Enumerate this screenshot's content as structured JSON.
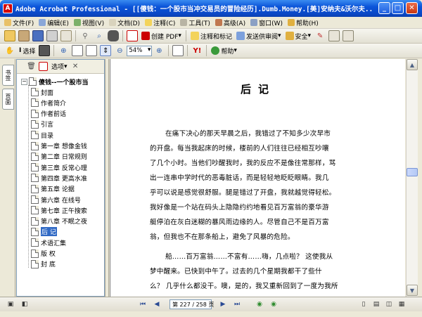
{
  "window": {
    "title": "Adobe Acrobat Professional - [[傻钱：一个股市当冲交易员的冒险经历].Dumb.Money.[美]安纳夫&沃尔夫..."
  },
  "menu": [
    "文件(F)",
    "编辑(E)",
    "视图(V)",
    "文档(D)",
    "注释(C)",
    "工具(T)",
    "高级(A)",
    "窗口(W)",
    "帮助(H)"
  ],
  "toolbar1": {
    "create_pdf": "创建 PDF",
    "review": "注释和标记",
    "send": "发送供审阅",
    "secure": "安全",
    "sign": "签名"
  },
  "toolbar2": {
    "select": "选择",
    "zoom": "54%",
    "help": "帮助"
  },
  "left_tabs": [
    "书签",
    "页面"
  ],
  "bookmarks": {
    "options": "选项",
    "root": "傻钱--一个股市当",
    "items": [
      "封面",
      "作者简介",
      "作者前话",
      "引言",
      "目录",
      "第一章 想像金钱",
      "第二章 日常规则",
      "第三章 反常心理",
      "第四章 更高水准",
      "第五章 论据",
      "第六章 在线号",
      "第七章 正午搜索",
      "第八章 不眠之夜",
      "后 记",
      "术语汇集",
      "版 权",
      "封 底"
    ],
    "selected": 13
  },
  "doc": {
    "heading": "后记",
    "lines": [
      "在痛下决心的那天早晨之后，我错过了不知多少次早市",
      "的开盘。每当我起床的时候，楼前的人们往往已经相互吵嚷",
      "了几个小时。当他们吵醒我时，我的反应不是像往常那样，骂",
      "出一连串中学时代的恶毒脏话，而是轻轻地眨眨眼睛。我几",
      "乎可以说是感觉很舒服。腿是错过了开盘，我就越觉得轻松。",
      "我好像是一个站在码头上隐隐约约地看见百万富翁的豪华游",
      "艇停泊在灰白迷糊的暴风雨边缘的人。尽管自己不是百万富",
      "翁，但我也不在那条船上，避免了风暴的危险。",
      "船……百万富翁……不富有……嗨，几点啦？ 这使我从",
      "梦中醒来。已快到中午了。过去的几个星期我都干了些什",
      "么？ 几乎什么都没干。噢，是的，我又重新回到了一度为我所",
      "忽视的网站的工作上来，开始非正式的工作和策划。从当冲"
    ]
  },
  "status": {
    "page_display": "第 227 / 258 页"
  }
}
